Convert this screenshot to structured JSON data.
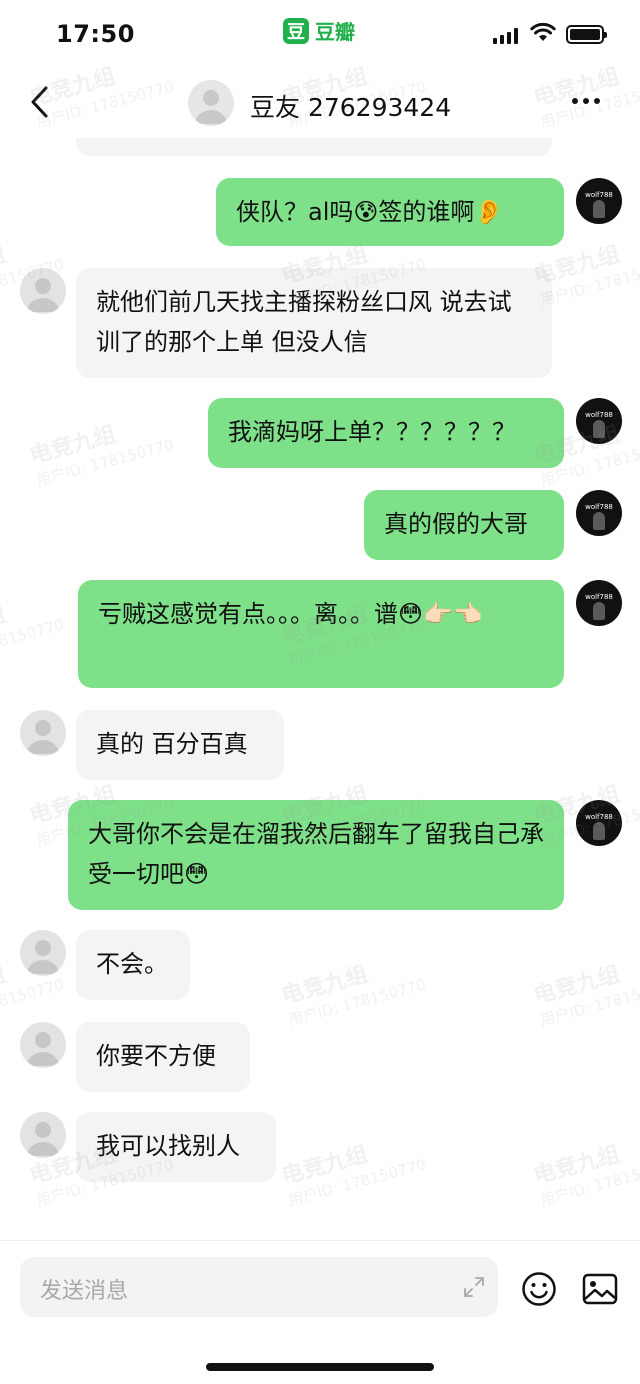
{
  "status": {
    "time": "17:50",
    "app_logo_char": "豆",
    "app_name": "豆瓣"
  },
  "header": {
    "title": "豆友 276293424"
  },
  "avatar_out_label": "wolf788",
  "messages": [
    {
      "dir": "out",
      "text": "侠队？al吗😰签的谁啊👂"
    },
    {
      "dir": "in",
      "text": "就他们前几天找主播探粉丝口风 说去试训了的那个上单 但没人信"
    },
    {
      "dir": "out",
      "text": "我滴妈呀上单？？？？？？"
    },
    {
      "dir": "out",
      "text": "真的假的大哥"
    },
    {
      "dir": "out",
      "text": "亏贼这感觉有点。。。离。。谱😳👉🏻👈🏻"
    },
    {
      "dir": "in",
      "text": "真的 百分百真"
    },
    {
      "dir": "out",
      "text": "大哥你不会是在溜我然后翻车了留我自己承受一切吧😳"
    },
    {
      "dir": "in",
      "text": "不会。"
    },
    {
      "dir": "in",
      "text": "你要不方便"
    },
    {
      "dir": "in",
      "text": "我可以找别人"
    }
  ],
  "input": {
    "placeholder": "发送消息"
  },
  "watermark": {
    "title": "电竞九组",
    "user": "用户ID: 178150770"
  }
}
